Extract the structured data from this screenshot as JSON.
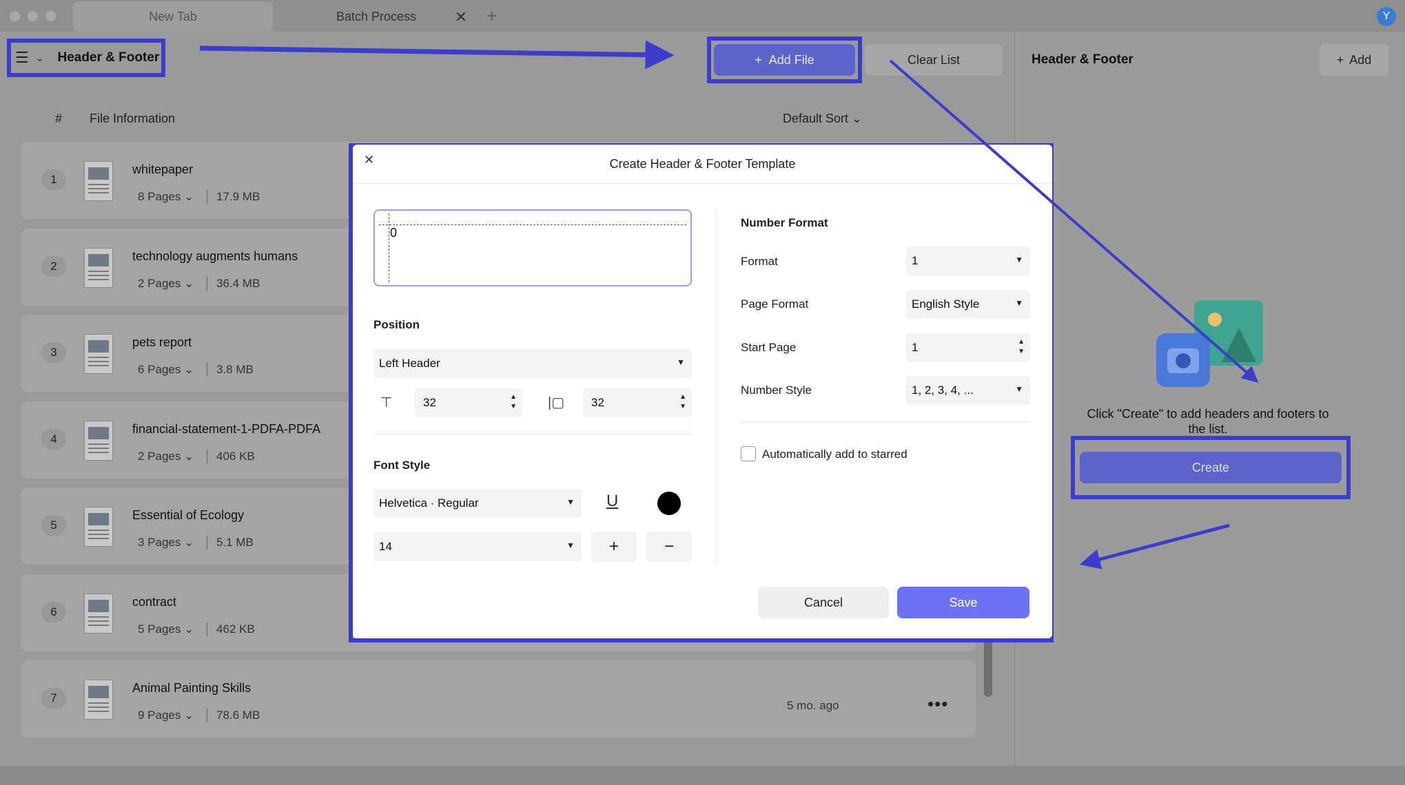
{
  "tabs": {
    "new_tab": "New Tab",
    "batch": "Batch Process",
    "close": "✕",
    "add": "+"
  },
  "avatar": "Y",
  "toolbar": {
    "menu_icon": "☰",
    "chevron": "⌄",
    "title": "Header & Footer",
    "add_file": "Add File",
    "add_file_icon": "+",
    "clear_list": "Clear List"
  },
  "list": {
    "col_num": "#",
    "col_info": "File Information",
    "sort": "Default Sort ⌄",
    "rows": [
      {
        "num": "1",
        "name": "whitepaper",
        "pages": "8 Pages ⌄",
        "size": "17.9 MB",
        "time": ""
      },
      {
        "num": "2",
        "name": "technology augments humans",
        "pages": "2 Pages ⌄",
        "size": "36.4 MB",
        "time": ""
      },
      {
        "num": "3",
        "name": "pets report",
        "pages": "6 Pages ⌄",
        "size": "3.8 MB",
        "time": ""
      },
      {
        "num": "4",
        "name": "financial-statement-1-PDFA-PDFA",
        "pages": "2 Pages ⌄",
        "size": "406 KB",
        "time": ""
      },
      {
        "num": "5",
        "name": "Essential of Ecology",
        "pages": "3 Pages ⌄",
        "size": "5.1 MB",
        "time": ""
      },
      {
        "num": "6",
        "name": "contract",
        "pages": "5 Pages ⌄",
        "size": "462 KB",
        "time": ""
      },
      {
        "num": "7",
        "name": "Animal Painting Skills",
        "pages": "9 Pages ⌄",
        "size": "78.6 MB",
        "time": "5 mo. ago"
      }
    ],
    "more": "•••"
  },
  "right_panel": {
    "title": "Header & Footer",
    "add_label": "Add",
    "add_icon": "+",
    "hint": "Click \"Create\" to add headers and footers to the list.",
    "create": "Create"
  },
  "dialog": {
    "close": "✕",
    "title": "Create Header & Footer Template",
    "preview_text": "0",
    "position_label": "Position",
    "position_value": "Left Header",
    "top_margin": "32",
    "side_margin": "32",
    "font_style_label": "Font Style",
    "font_value": "Helvetica · Regular",
    "font_size": "14",
    "plus": "+",
    "minus": "−",
    "underline_icon": "U",
    "number_format_label": "Number Format",
    "format_label": "Format",
    "format_value": "1",
    "page_format_label": "Page Format",
    "page_format_value": "English Style",
    "start_page_label": "Start Page",
    "start_page_value": "1",
    "number_style_label": "Number Style",
    "number_style_value": "1, 2, 3, 4, ...",
    "auto_star_label": "Automatically add to starred",
    "cancel": "Cancel",
    "save": "Save"
  },
  "colors": {
    "accent": "#6d72f2",
    "highlight": "#3d3dcc",
    "dim_bg": "#9a9a9a"
  }
}
